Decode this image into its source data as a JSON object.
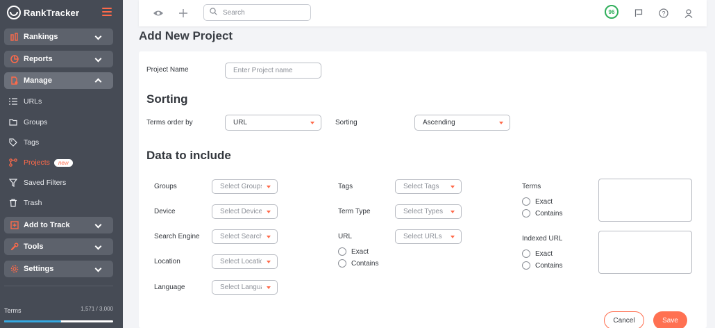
{
  "app": {
    "brand": "RankTracker"
  },
  "sidebar": {
    "groups": {
      "rankings": "Rankings",
      "reports": "Reports",
      "manage": "Manage",
      "add_to_track": "Add to Track",
      "tools": "Tools",
      "settings": "Settings"
    },
    "manage_items": {
      "urls": "URLs",
      "groups": "Groups",
      "tags": "Tags",
      "projects": "Projects",
      "projects_badge": "new",
      "saved_filters": "Saved Filters",
      "trash": "Trash"
    },
    "terms": {
      "label": "Terms",
      "count": "1,571 / 3,000",
      "usage_fraction": 0.52
    }
  },
  "topbar": {
    "search_placeholder": "Search",
    "score": "96"
  },
  "page": {
    "title": "Add New Project"
  },
  "form": {
    "project_name_label": "Project Name",
    "project_name_placeholder": "Enter Project name",
    "sorting_title": "Sorting",
    "terms_order_label": "Terms order by",
    "terms_order_value": "URL",
    "sorting_label": "Sorting",
    "sorting_value": "Ascending",
    "data_title": "Data to include",
    "groups_label": "Groups",
    "groups_placeholder": "Select Groups",
    "device_label": "Device",
    "device_placeholder": "Select Devices",
    "search_engine_label": "Search Engine",
    "search_engine_placeholder": "Select Search E",
    "location_label": "Location",
    "location_placeholder": "Select Location",
    "language_label": "Language",
    "language_placeholder": "Select Languag",
    "tags_label": "Tags",
    "tags_placeholder": "Select Tags",
    "term_type_label": "Term Type",
    "term_type_placeholder": "Select Types",
    "url_label": "URL",
    "url_placeholder": "Select URLs",
    "url_exact": "Exact",
    "url_contains": "Contains",
    "terms_label": "Terms",
    "terms_exact": "Exact",
    "terms_contains": "Contains",
    "indexed_url_label": "Indexed URL",
    "indexed_exact": "Exact",
    "indexed_contains": "Contains"
  },
  "actions": {
    "cancel": "Cancel",
    "save": "Save"
  },
  "colors": {
    "accent": "#ff6a4a",
    "sidebar_bg": "#464b55",
    "score_green": "#2fae5a",
    "progress": "#36a9e1"
  }
}
